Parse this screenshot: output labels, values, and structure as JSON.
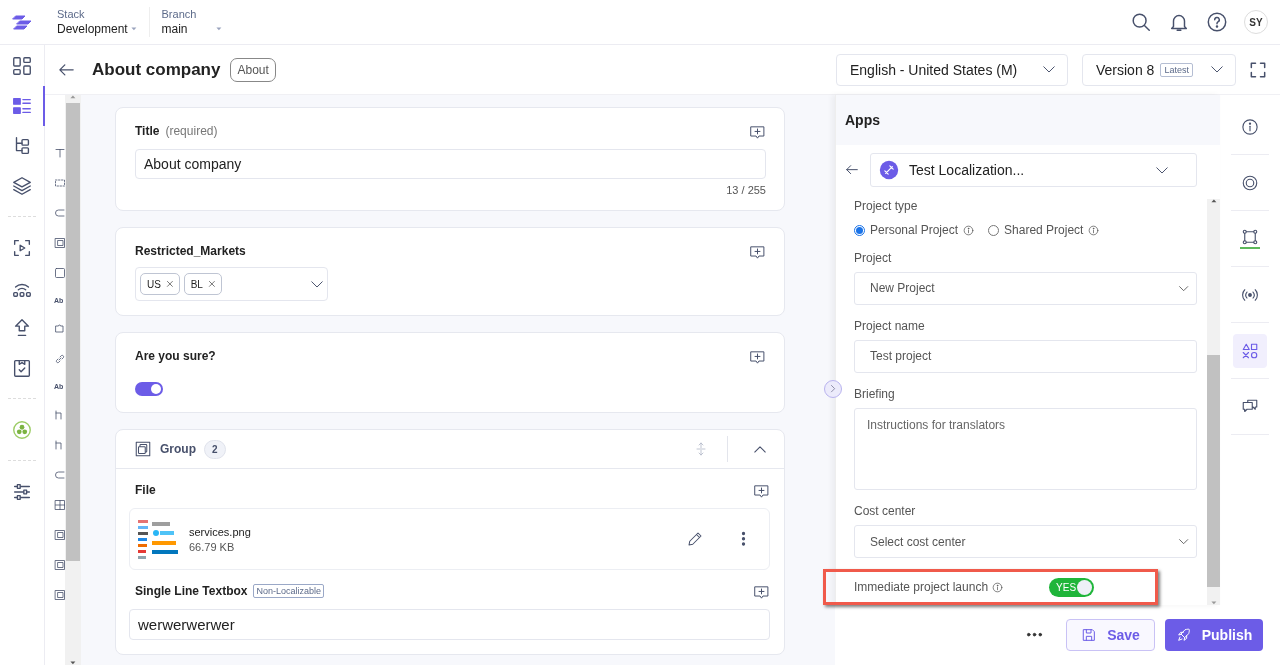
{
  "topbar": {
    "stack_label": "Stack",
    "stack_value": "Development",
    "branch_label": "Branch",
    "branch_value": "main",
    "avatar": "SY"
  },
  "nav": [
    {
      "kind": "dashboard",
      "selected": false
    },
    {
      "kind": "entries",
      "selected": true
    },
    {
      "kind": "tree",
      "selected": false
    },
    {
      "kind": "layers",
      "selected": false
    },
    {
      "kind": "play",
      "selected": false
    },
    {
      "kind": "signal",
      "selected": false
    },
    {
      "kind": "upload",
      "selected": false
    },
    {
      "kind": "clipboard",
      "selected": false
    },
    {
      "kind": "app",
      "selected": false
    },
    {
      "kind": "sliders",
      "selected": false
    }
  ],
  "header": {
    "title": "About company",
    "tag": "About",
    "locale": "English - United States (M)",
    "version": "Version 8",
    "version_badge": "Latest"
  },
  "palette": [
    {
      "kind": "title"
    },
    {
      "kind": "dashed"
    },
    {
      "kind": "round"
    },
    {
      "kind": "group"
    },
    {
      "kind": "square"
    },
    {
      "kind": "label",
      "text": "Ab"
    },
    {
      "kind": "puzzle"
    },
    {
      "kind": "link"
    },
    {
      "kind": "label",
      "text": "Ab"
    },
    {
      "kind": "corner"
    },
    {
      "kind": "corner"
    },
    {
      "kind": "round"
    },
    {
      "kind": "grid"
    },
    {
      "kind": "group"
    },
    {
      "kind": "group"
    },
    {
      "kind": "group"
    }
  ],
  "fields": [
    {
      "kind": "text",
      "label": "Title",
      "hint": "(required)",
      "value": "About company",
      "count": "13 / 255"
    },
    {
      "kind": "tags",
      "label": "Restricted_Markets",
      "tags": [
        "US",
        "BL"
      ]
    },
    {
      "kind": "toggle",
      "label": "Are you sure?",
      "on": true
    },
    {
      "kind": "group",
      "label": "Group",
      "count": "2",
      "expanded": true,
      "children": [
        {
          "kind": "file",
          "label": "File",
          "name": "services.png",
          "size": "66.79 KB"
        },
        {
          "kind": "text",
          "label": "Single Line Textbox",
          "badge": "Non-Localizable",
          "value": "werwerwerwer"
        }
      ]
    }
  ],
  "apps_panel": {
    "title": "Apps",
    "app": "Test Localization...",
    "project_type_label": "Project type",
    "project_types": [
      {
        "label": "Personal Project",
        "selected": true
      },
      {
        "label": "Shared Project",
        "selected": false
      }
    ],
    "project_label": "Project",
    "project_value": "New Project",
    "project_name_label": "Project name",
    "project_name_value": "Test project",
    "briefing_label": "Briefing",
    "briefing_placeholder": "Instructions for translators",
    "cost_center_label": "Cost center",
    "cost_center_placeholder": "Select cost center",
    "launch_label": "Immediate project launch",
    "launch_on": true,
    "launch_text": "YES",
    "highlighted": true
  },
  "actions": {
    "save": "Save",
    "publish": "Publish"
  },
  "right_rail": [
    {
      "kind": "info",
      "selected": false,
      "underline": false
    },
    {
      "kind": "target",
      "selected": false,
      "underline": false
    },
    {
      "kind": "nodes",
      "selected": false,
      "underline": true
    },
    {
      "kind": "broadcast",
      "selected": false,
      "underline": false
    },
    {
      "kind": "shapes",
      "selected": true,
      "underline": false
    },
    {
      "kind": "chat",
      "selected": false,
      "underline": false
    }
  ]
}
